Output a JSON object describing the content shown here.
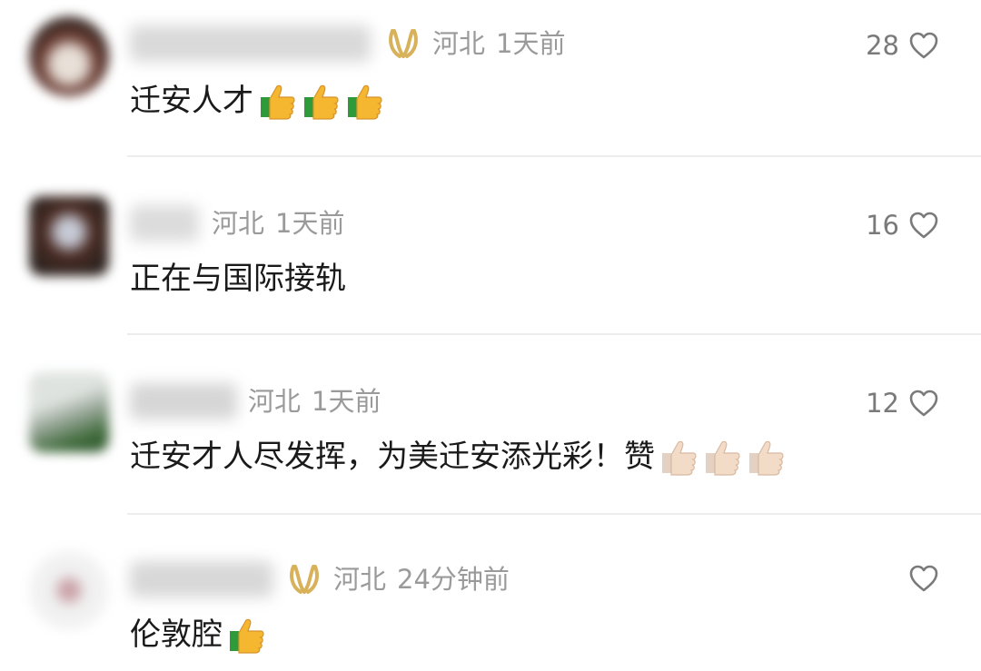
{
  "colors": {
    "meta_text": "#9a9a9a",
    "content_text": "#1a1a1a",
    "badge_gold": "#d8b25a",
    "thumb_yellow": "#f5b630",
    "thumb_light": "#f2dcc8",
    "cuff_green": "#2f9a3a",
    "divider": "#ededed"
  },
  "comments": [
    {
      "location": "河北",
      "time": "1天前",
      "text": "迁安人才",
      "like_count": "28",
      "has_badge": true,
      "emoji": "thumbs-up-yellow",
      "emoji_count": 3
    },
    {
      "location": "河北",
      "time": "1天前",
      "text": "正在与国际接轨",
      "like_count": "16",
      "has_badge": false,
      "emoji": null,
      "emoji_count": 0
    },
    {
      "location": "河北",
      "time": "1天前",
      "text": "迁安才人尽发挥，为美迁安添光彩！赞",
      "like_count": "12",
      "has_badge": false,
      "emoji": "thumbs-up-light",
      "emoji_count": 3
    },
    {
      "location": "河北",
      "time": "24分钟前",
      "text": "伦敦腔",
      "like_count": "",
      "has_badge": true,
      "emoji": "thumbs-up-yellow",
      "emoji_count": 1
    }
  ]
}
